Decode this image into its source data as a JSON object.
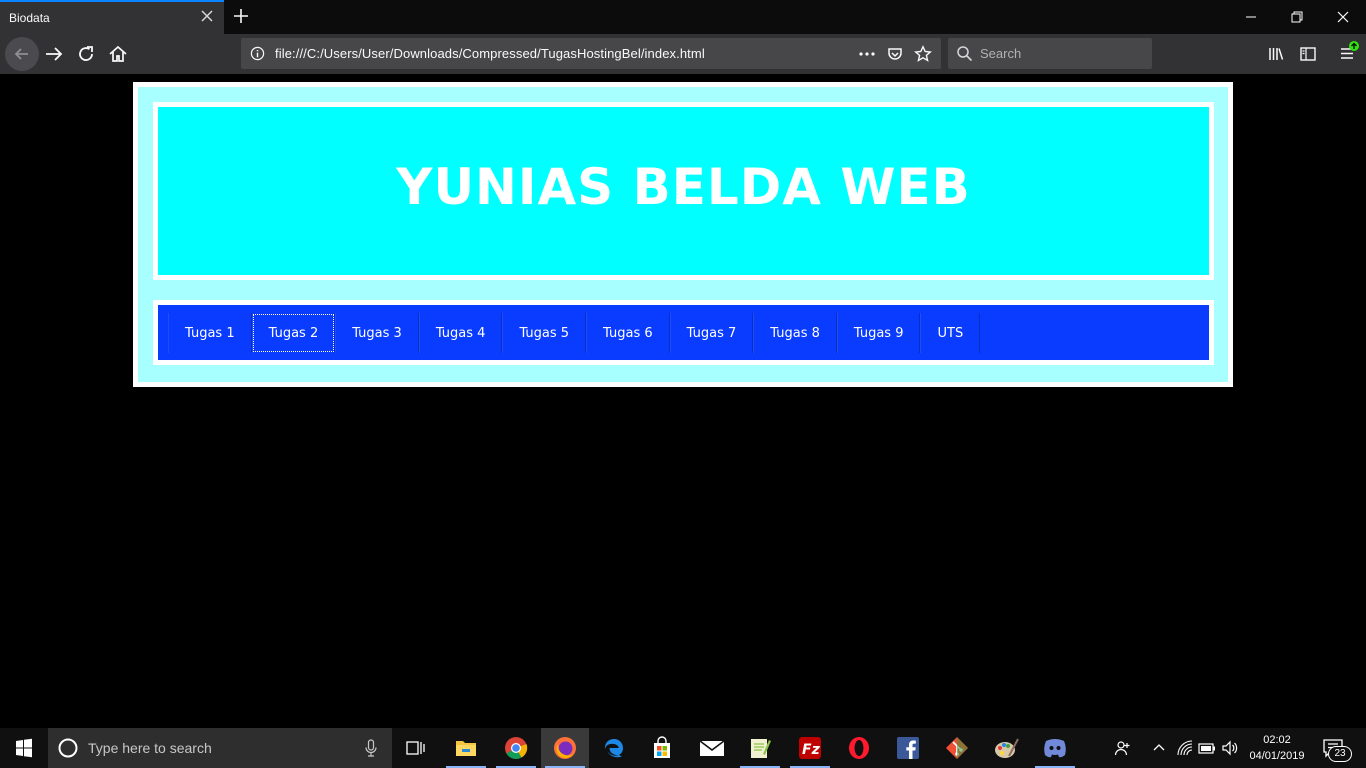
{
  "browser": {
    "tab_title": "Biodata",
    "url": "file:///C:/Users/User/Downloads/Compressed/TugasHostingBel/index.html",
    "search_placeholder": "Search",
    "accent_color": "#0a84ff"
  },
  "page": {
    "title": "YUNIAS BELDA WEB",
    "header_color": "#00ffff",
    "menu_color": "#0a3cff",
    "menu_items": [
      {
        "label": "Tugas 1"
      },
      {
        "label": "Tugas 2"
      },
      {
        "label": "Tugas 3"
      },
      {
        "label": "Tugas 4"
      },
      {
        "label": "Tugas 5"
      },
      {
        "label": "Tugas 6"
      },
      {
        "label": "Tugas 7"
      },
      {
        "label": "Tugas 8"
      },
      {
        "label": "Tugas 9"
      },
      {
        "label": "UTS"
      }
    ],
    "focused_menu_item": "Tugas 2"
  },
  "taskbar": {
    "search_placeholder": "Type here to search",
    "time": "02:02",
    "date": "04/01/2019",
    "notification_count": "23",
    "apps": [
      "task-view",
      "file-explorer",
      "chrome",
      "firefox",
      "edge",
      "store",
      "mail",
      "notepad-plus-plus",
      "filezilla",
      "opera",
      "facebook",
      "git",
      "paint"
    ]
  }
}
